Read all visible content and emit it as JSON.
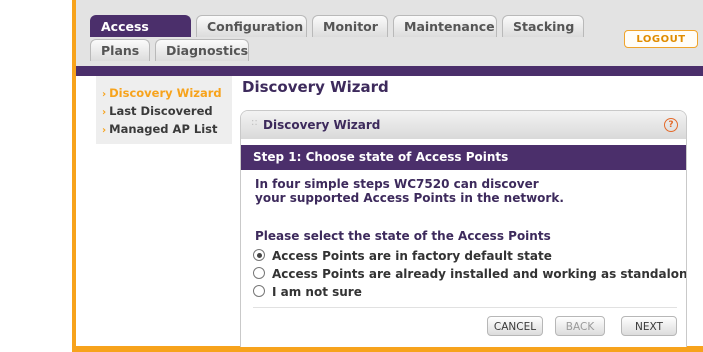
{
  "tabs": [
    {
      "label": "Access Point",
      "active": true
    },
    {
      "label": "Configuration",
      "active": false
    },
    {
      "label": "Monitor",
      "active": false
    },
    {
      "label": "Maintenance",
      "active": false
    },
    {
      "label": "Stacking",
      "active": false
    },
    {
      "label": "Plans",
      "active": false
    },
    {
      "label": "Diagnostics",
      "active": false
    }
  ],
  "logout_label": "LOGOUT",
  "sidebar": {
    "items": [
      {
        "label": "Discovery Wizard",
        "active": true
      },
      {
        "label": "Last Discovered",
        "active": false
      },
      {
        "label": "Managed AP List",
        "active": false
      }
    ]
  },
  "page_title": "Discovery Wizard",
  "panel": {
    "title": "Discovery Wizard",
    "step": "Step 1: Choose state of Access Points",
    "intro_line1": "In four simple steps WC7520 can discover",
    "intro_line2": "your supported Access Points in the network.",
    "question": "Please select the state of the Access Points",
    "options": [
      {
        "label": "Access Points are in factory default state",
        "selected": true
      },
      {
        "label": "Access Points are already installed and working as standalone",
        "selected": false
      },
      {
        "label": "I am not sure",
        "selected": false
      }
    ]
  },
  "buttons": {
    "cancel": "CANCEL",
    "back": "BACK",
    "next": "NEXT"
  },
  "colors": {
    "accent_orange": "#f7a31c",
    "brand_purple": "#4b2f6b"
  }
}
